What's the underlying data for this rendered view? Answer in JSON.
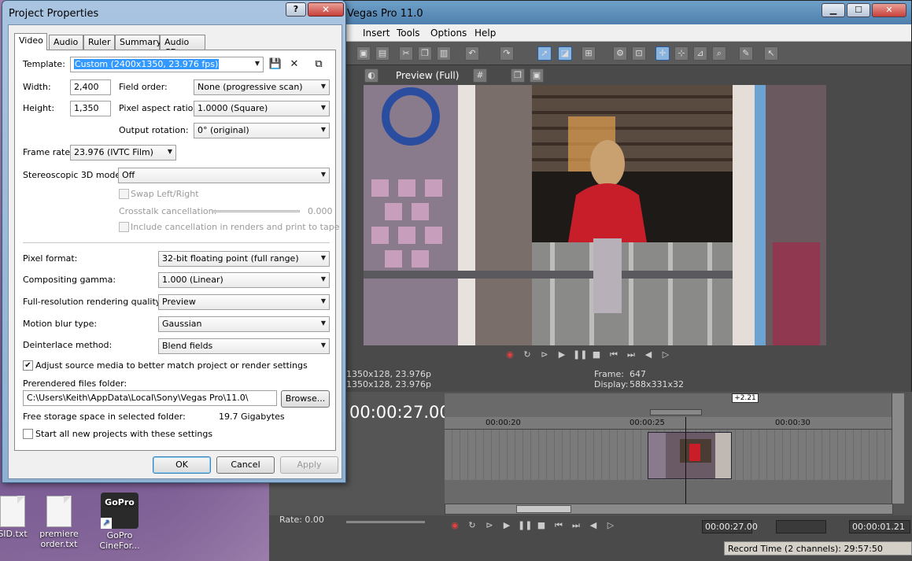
{
  "desktop": {
    "icons": [
      {
        "label": "SID.txt"
      },
      {
        "label": "premiere order.txt"
      },
      {
        "label": "GoPro CineFor...",
        "logo_text": "GoPro"
      }
    ]
  },
  "vegas": {
    "title": "Vegas Pro 11.0",
    "window_buttons": {
      "minimize": "▁",
      "maximize": "☐",
      "close": "✕"
    },
    "menu": [
      "Insert",
      "Tools",
      "Options",
      "Help"
    ],
    "preview_mode": "Preview (Full)",
    "project_info_1": "1350x128, 23.976p",
    "project_info_2": "1350x128, 23.976p",
    "frame_label": "Frame:",
    "frame_value": "647",
    "display_label": "Display:",
    "display_value": "588x331x32",
    "timecode": "00:00:27.00",
    "ruler_marks": [
      "00:00:20",
      "00:00:25",
      "00:00:30"
    ],
    "rate_label": "Rate: 0.00",
    "level_badge": "+2.21",
    "cursor_time": "00:00:27.00",
    "selection_length": "00:00:01.21",
    "status": "Record Time (2 channels): 29:57:50"
  },
  "dialog": {
    "title": "Project Properties",
    "help_button": "?",
    "close_button": "✕",
    "tabs": [
      "Video",
      "Audio",
      "Ruler",
      "Summary",
      "Audio CD"
    ],
    "active_tab": "Video",
    "template_label": "Template:",
    "template_value": "Custom (2400x1350, 23.976 fps)",
    "width_label": "Width:",
    "width_value": "2,400",
    "height_label": "Height:",
    "height_value": "1,350",
    "field_order_label": "Field order:",
    "field_order_value": "None (progressive scan)",
    "par_label": "Pixel aspect ratio:",
    "par_value": "1.0000 (Square)",
    "rotation_label": "Output rotation:",
    "rotation_value": "0° (original)",
    "frame_rate_label": "Frame rate:",
    "frame_rate_value": "23.976 (IVTC Film)",
    "stereo_label": "Stereoscopic 3D mode:",
    "stereo_value": "Off",
    "swap_label": "Swap Left/Right",
    "crosstalk_label": "Crosstalk cancellation:",
    "crosstalk_value": "0.000",
    "include_cancel_label": "Include cancellation in renders and print to tape",
    "pixel_format_label": "Pixel format:",
    "pixel_format_value": "32-bit floating point (full range)",
    "gamma_label": "Compositing gamma:",
    "gamma_value": "1.000 (Linear)",
    "quality_label": "Full-resolution rendering quality:",
    "quality_value": "Preview",
    "motion_blur_label": "Motion blur type:",
    "motion_blur_value": "Gaussian",
    "deinterlace_label": "Deinterlace method:",
    "deinterlace_value": "Blend fields",
    "adjust_label": "Adjust source media to better match project or render settings",
    "adjust_checked": true,
    "prerendered_label": "Prerendered files folder:",
    "prerendered_value": "C:\\Users\\Keith\\AppData\\Local\\Sony\\Vegas Pro\\11.0\\",
    "browse_label": "Browse...",
    "free_space_label": "Free storage space in selected folder:",
    "free_space_value": "19.7 Gigabytes",
    "start_all_label": "Start all new projects with these settings",
    "ok_label": "OK",
    "cancel_label": "Cancel",
    "apply_label": "Apply"
  }
}
